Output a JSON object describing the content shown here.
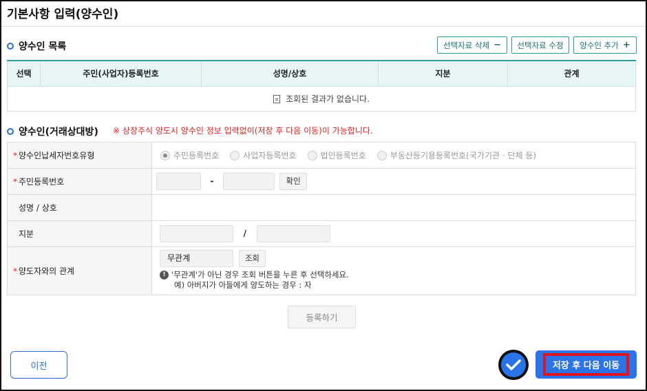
{
  "page_title": "기본사항 입력(양수인)",
  "list_section": {
    "title": "양수인 목록",
    "buttons": {
      "delete": "선택자료 삭제",
      "delete_symbol": "−",
      "edit": "선택자료 수정",
      "add": "양수인 추가",
      "add_symbol": "+"
    },
    "columns": [
      "선택",
      "주민(사업자)등록번호",
      "성명/상호",
      "지분",
      "관계"
    ],
    "empty_message": "조회된 결과가 없습니다."
  },
  "form_section": {
    "title": "양수인(거래상대방)",
    "notice": "※ 상장주식 양도시 양수인 정보 입력없이(저장 후 다음 이동)이 가능합니다.",
    "required_mark": "*",
    "rows": {
      "type_label": "양수인납세자번호유형",
      "id_label": "주민등록번호",
      "name_label": "성명 / 상호",
      "share_label": "지분",
      "relation_label": "양도자와의 관계"
    },
    "radio_options": [
      "주민등록번호",
      "사업자등록번호",
      "법인등록번호",
      "부동산등기용등록번호(국가기관 · 단체 등)"
    ],
    "selected_option": "주민등록번호",
    "id_separator": "-",
    "confirm_button": "확인",
    "share_separator": "/",
    "relation_value": "무관계",
    "lookup_button": "조회",
    "info_line1": "'무관계'가 아닌 경우 조회 버튼을 누른 후 선택하세요.",
    "info_line2": "예) 아버지가 아들에게 양도하는 경우 : 자",
    "info_icon": "!"
  },
  "register_button": "등록하기",
  "prev_button": "이전",
  "save_next_button": "저장 후 다음 이동",
  "icons": {
    "section": "bullet-circle-icon",
    "empty": "document-icon",
    "info": "info-icon",
    "check": "checkmark-icon"
  },
  "colors": {
    "accent": "#2a73e8",
    "teal": "#2a9d9d",
    "notice": "#e02020",
    "highlight": "#e0141e"
  }
}
